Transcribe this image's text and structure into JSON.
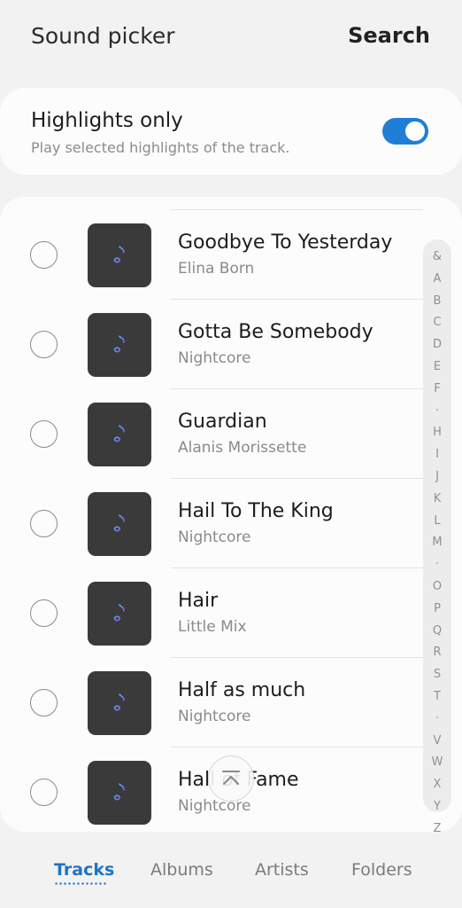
{
  "header": {
    "title": "Sound picker",
    "search_label": "Search"
  },
  "highlights": {
    "title": "Highlights only",
    "subtitle": "Play selected highlights of the track.",
    "enabled": true
  },
  "colors": {
    "accent": "#1f7fd6",
    "thumb_bg": "#3a3a3a",
    "note_gradient_start": "#4aa8f0",
    "note_gradient_end": "#8a5cf0"
  },
  "tracks": [
    {
      "name": "Goodbye To Yesterday",
      "artist": "Elina Born"
    },
    {
      "name": "Gotta Be Somebody",
      "artist": "Nightcore"
    },
    {
      "name": "Guardian",
      "artist": "Alanis Morissette"
    },
    {
      "name": "Hail To The King",
      "artist": "Nightcore"
    },
    {
      "name": "Hair",
      "artist": "Little Mix"
    },
    {
      "name": "Half as much",
      "artist": "Nightcore"
    },
    {
      "name": "Hall of Fame",
      "artist": "Nightcore"
    }
  ],
  "index_letters": [
    "&",
    "A",
    "B",
    "C",
    "D",
    "E",
    "F",
    "·",
    "H",
    "I",
    "J",
    "K",
    "L",
    "M",
    "·",
    "O",
    "P",
    "Q",
    "R",
    "S",
    "T",
    "·",
    "V",
    "W",
    "X",
    "Y",
    "Z"
  ],
  "tabs": [
    {
      "label": "Tracks",
      "active": true
    },
    {
      "label": "Albums",
      "active": false
    },
    {
      "label": "Artists",
      "active": false
    },
    {
      "label": "Folders",
      "active": false
    }
  ]
}
